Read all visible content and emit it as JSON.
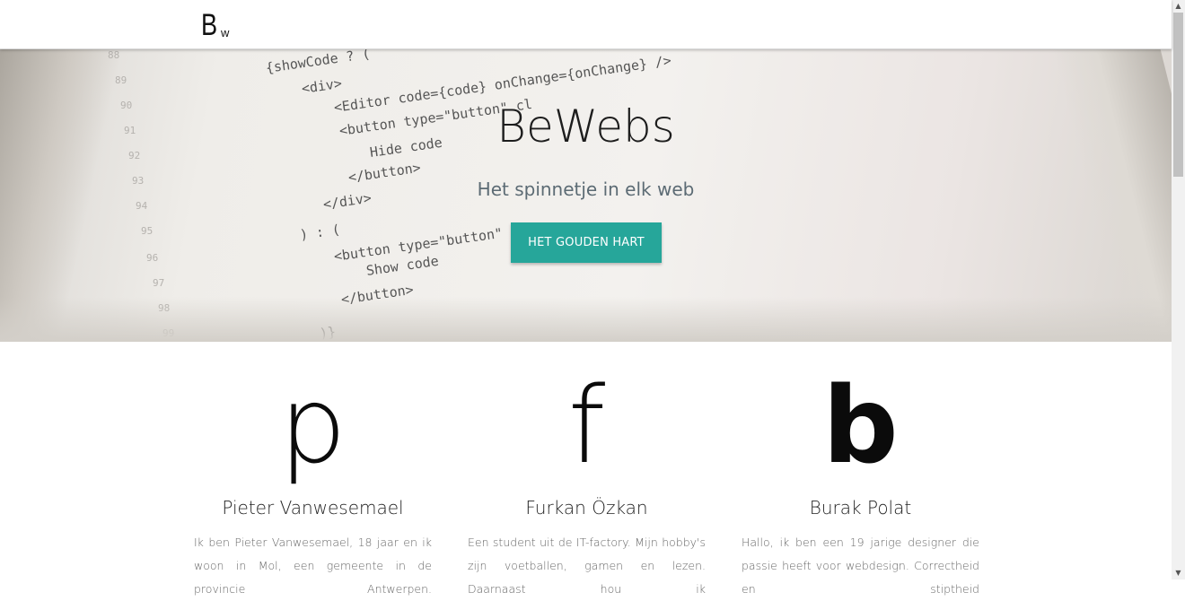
{
  "nav": {
    "logo_big": "B",
    "logo_small": "w"
  },
  "hero": {
    "title": "BeWebs",
    "subtitle": "Het spinnetje in elk web",
    "button": "HET GOUDEN HART",
    "code_lines": [
      "{showCode ? (",
      "<div>",
      "<Editor code={code} onChange={onChange} />",
      "<button type=\"button\" cl",
      "Hide code",
      "</button>",
      "</div>",
      ") : (",
      "<button type=\"button\" cl",
      "Show code",
      "</button>",
      ")}"
    ],
    "line_numbers": [
      "88",
      "89",
      "90",
      "91",
      "92",
      "93",
      "94",
      "95",
      "96",
      "97",
      "98",
      "99"
    ]
  },
  "team": [
    {
      "letter": "p",
      "name": "Pieter Vanwesemael",
      "bio": "Ik ben Pieter Vanwesemael, 18 jaar en ik woon in Mol, een gemeente in de provincie Antwerpen."
    },
    {
      "letter": "f",
      "name": "Furkan Özkan",
      "bio": "Een student uit de IT-factory. Mijn hobby's zijn voetballen, gamen en lezen. Daarnaast hou ik"
    },
    {
      "letter": "b",
      "name": "Burak Polat",
      "bio": "Hallo, ik ben een 19 jarige designer die passie heeft voor webdesign. Correctheid en stiptheid"
    }
  ],
  "scrollbar": {
    "up_icon": "triangle-up",
    "down_icon": "triangle-down"
  }
}
